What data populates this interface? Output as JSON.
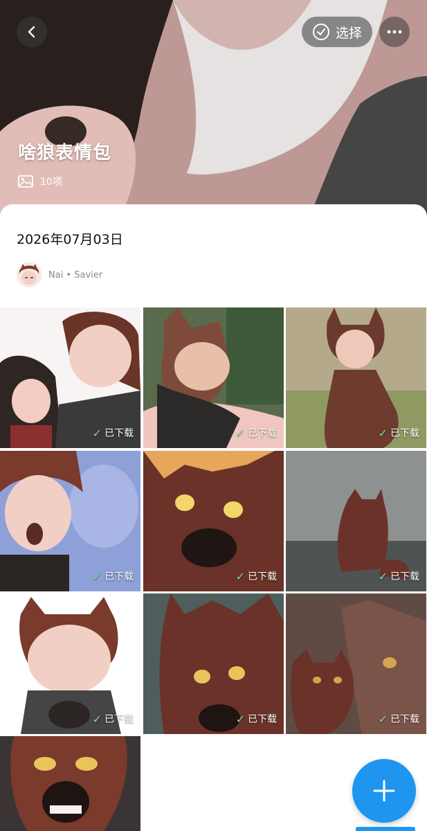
{
  "header": {
    "select_label": "选择",
    "album_title": "啥狼表情包",
    "item_count": "10项"
  },
  "sheet": {
    "date": "2026年07月03日",
    "author_name": "Nai • Savier"
  },
  "grid": {
    "download_label": "已下载",
    "items": [
      {
        "downloaded": true
      },
      {
        "downloaded": true
      },
      {
        "downloaded": true
      },
      {
        "downloaded": true
      },
      {
        "downloaded": true
      },
      {
        "downloaded": true
      },
      {
        "downloaded": true
      },
      {
        "downloaded": true
      },
      {
        "downloaded": true
      },
      {
        "downloaded": false
      }
    ]
  },
  "icons": {
    "back": "chevron-left-icon",
    "select": "check-circle-icon",
    "more": "more-dots-icon",
    "image": "image-icon",
    "download_check": "checkmark-icon",
    "add": "plus-icon"
  },
  "colors": {
    "accent": "#1e96f0",
    "download_check": "#7ee28f"
  }
}
